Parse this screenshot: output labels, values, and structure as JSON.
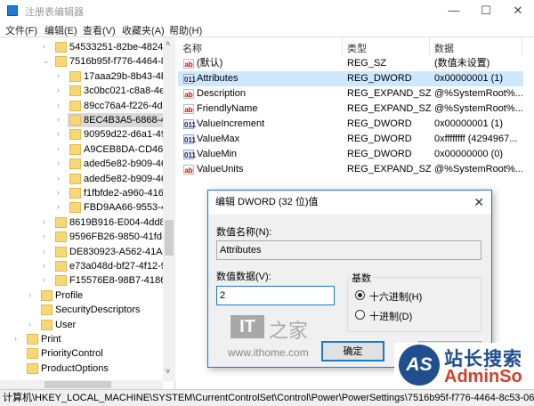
{
  "window": {
    "title": "注册表编辑器",
    "minimize": "—",
    "maximize": "☐",
    "close": "✕"
  },
  "menu": [
    "文件(F)",
    "编辑(E)",
    "查看(V)",
    "收藏夹(A)",
    "帮助(H)"
  ],
  "tree": [
    {
      "label": "54533251-82be-4824-96c",
      "level": 2,
      "expand": "›"
    },
    {
      "label": "7516b95f-f776-4464-8c53",
      "level": 2,
      "expand": "⌄"
    },
    {
      "label": "17aaa29b-8b43-4b94-",
      "level": 3,
      "expand": "›"
    },
    {
      "label": "3c0bc021-c8a8-4e07-a",
      "level": 3,
      "expand": "›"
    },
    {
      "label": "89cc76a4-f226-4d4b-a",
      "level": 3,
      "expand": "›"
    },
    {
      "label": "8EC4B3A5-6868-48c2-",
      "level": 3,
      "expand": "›",
      "selected": true
    },
    {
      "label": "90959d22-d6a1-49b9-",
      "level": 3,
      "expand": "›"
    },
    {
      "label": "A9CEB8DA-CD46-44FE",
      "level": 3,
      "expand": "›"
    },
    {
      "label": "aded5e82-b909-4619-",
      "level": 3,
      "expand": "›"
    },
    {
      "label": "aded5e82-b909-4619-",
      "level": 3,
      "expand": "›"
    },
    {
      "label": "f1fbfde2-a960-4165-9",
      "level": 3,
      "expand": "›"
    },
    {
      "label": "FBD9AA66-9553-4097",
      "level": 3,
      "expand": "›"
    },
    {
      "label": "8619B916-E004-4dd8-9B",
      "level": 2,
      "expand": "›"
    },
    {
      "label": "9596FB26-9850-41fd-AC3",
      "level": 2,
      "expand": "›"
    },
    {
      "label": "DE830923-A562-41AF-A0",
      "level": 2,
      "expand": "›"
    },
    {
      "label": "e73a048d-bf27-4f12-973",
      "level": 2,
      "expand": "›"
    },
    {
      "label": "F15576E8-98B7-4186-B94",
      "level": 2,
      "expand": "›"
    },
    {
      "label": "Profile",
      "level": 1,
      "expand": "›"
    },
    {
      "label": "SecurityDescriptors",
      "level": 1,
      "expand": ""
    },
    {
      "label": "User",
      "level": 1,
      "expand": "›"
    },
    {
      "label": "Print",
      "level": 0,
      "expand": "›"
    },
    {
      "label": "PriorityControl",
      "level": 0,
      "expand": ""
    },
    {
      "label": "ProductOptions",
      "level": 0,
      "expand": ""
    }
  ],
  "list": {
    "headers": [
      "名称",
      "类型",
      "数据"
    ],
    "rows": [
      {
        "icon": "string-value-icon",
        "name": "(默认)",
        "type": "REG_SZ",
        "data": "(数值未设置)"
      },
      {
        "icon": "binary-value-icon",
        "name": "Attributes",
        "type": "REG_DWORD",
        "data": "0x00000001 (1)",
        "highlight": true
      },
      {
        "icon": "string-value-icon",
        "name": "Description",
        "type": "REG_EXPAND_SZ",
        "data": "@%SystemRoot%..."
      },
      {
        "icon": "string-value-icon",
        "name": "FriendlyName",
        "type": "REG_EXPAND_SZ",
        "data": "@%SystemRoot%..."
      },
      {
        "icon": "binary-value-icon",
        "name": "ValueIncrement",
        "type": "REG_DWORD",
        "data": "0x00000001 (1)"
      },
      {
        "icon": "binary-value-icon",
        "name": "ValueMax",
        "type": "REG_DWORD",
        "data": "0xffffffff (4294967..."
      },
      {
        "icon": "binary-value-icon",
        "name": "ValueMin",
        "type": "REG_DWORD",
        "data": "0x00000000 (0)"
      },
      {
        "icon": "string-value-icon",
        "name": "ValueUnits",
        "type": "REG_EXPAND_SZ",
        "data": "@%SystemRoot%..."
      }
    ]
  },
  "status": "计算机\\HKEY_LOCAL_MACHINE\\SYSTEM\\CurrentControlSet\\Control\\Power\\PowerSettings\\7516b95f-f776-4464-8c53-06167f40cc99\\8EC4B3A5-6868-48c2-",
  "dialog": {
    "title": "编辑 DWORD (32 位)值",
    "close": "✕",
    "name_label": "数值名称(N):",
    "name_value": "Attributes",
    "data_label": "数值数据(V):",
    "data_value": "2",
    "base_label": "基数",
    "hex_label": "十六进制(H)",
    "dec_label": "十进制(D)",
    "hex_selected": true,
    "ok": "确定",
    "cancel": ""
  },
  "watermarks": {
    "ithome_logo": "IT之家",
    "ithome_url": "www.ithome.com",
    "adminso_logo": "AS",
    "adminso_cn": "站长搜索",
    "adminso_en": "AdminSo"
  },
  "colors": {
    "accent": "#1979ca",
    "selection": "#cce8ff",
    "folder": "#f8d774"
  }
}
